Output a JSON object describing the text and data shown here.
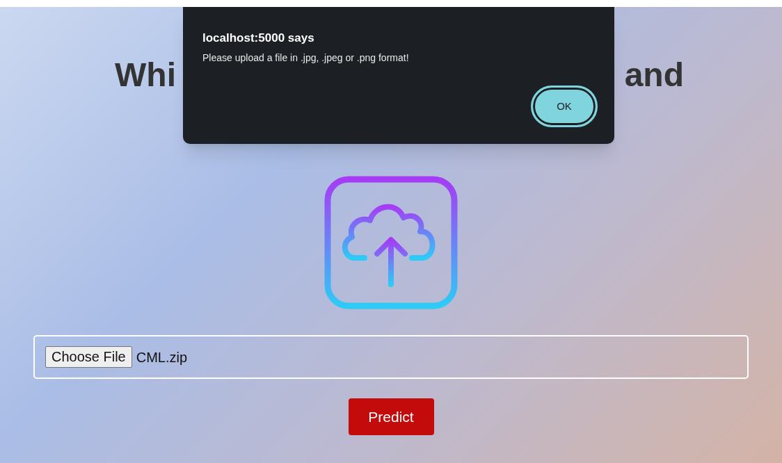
{
  "heading": {
    "left_part": "Whi",
    "right_part": "and"
  },
  "file_input": {
    "button": "Choose File",
    "value": "CML.zip"
  },
  "predict_button": "Predict",
  "alert": {
    "title": "localhost:5000 says",
    "message": "Please upload a file in .jpg, .jpeg or .png format!",
    "button": "OK"
  }
}
